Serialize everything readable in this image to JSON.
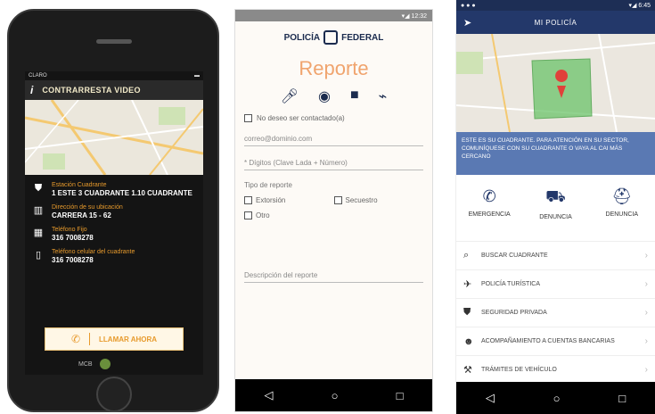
{
  "phone1": {
    "status": {
      "carrier": "CLARO",
      "time": "",
      "battery": "▬"
    },
    "header": {
      "title": "CONTRARRESTA VIDEO"
    },
    "rows": [
      {
        "icon": "shield-icon",
        "label": "Estación Cuadrante",
        "value": "1 ESTE 3 CUADRANTE 1.10 CUADRANTE"
      },
      {
        "icon": "map-icon",
        "label": "Dirección de su ubicación",
        "value": "CARRERA 15 - 62"
      },
      {
        "icon": "calendar-icon",
        "label": "Teléfono Fijo",
        "value": "316 7008278"
      },
      {
        "icon": "mobile-icon",
        "label": "Teléfono celular del cuadrante",
        "value": "316 7008278"
      }
    ],
    "call_button": "LLAMAR AHORA",
    "logos": [
      "MCB"
    ]
  },
  "phone2": {
    "status": "▾◢ 12:32",
    "brand_left": "POLICÍA",
    "brand_right": "FEDERAL",
    "title": "Reporte",
    "icons": [
      "microphone-icon",
      "camera-icon",
      "video-icon",
      "attachment-icon"
    ],
    "anonymous_label": "No deseo ser contactado(a)",
    "email_placeholder": "correo@dominio.com",
    "phone_placeholder": "* Dígitos (Clave Lada + Número)",
    "type_label": "Tipo de reporte",
    "options": [
      {
        "label": "Extorsión",
        "hint": ""
      },
      {
        "label": "Secuestro",
        "hint": ""
      },
      {
        "label": "Otro",
        "hint": ""
      }
    ],
    "description_label": "Descripción del reporte"
  },
  "phone3": {
    "status_left": "● ● ●",
    "status_right": "▾◢ 6:45",
    "app_title": "MI POLICÍA",
    "banner_text": "ESTE ES SU CUADRANTE. PARA ATENCIÓN EN SU SECTOR, COMUNÍQUESE CON SU CUADRANTE O VAYA AL CAI MÁS CERCANO",
    "actions": [
      {
        "icon": "phone-icon",
        "label": "EMERGENCIA"
      },
      {
        "icon": "car-icon",
        "label": "DENUNCIA"
      },
      {
        "icon": "police-hat-icon",
        "label": "DENUNCIA"
      }
    ],
    "list": [
      {
        "icon": "search-icon",
        "label": "BUSCAR CUADRANTE"
      },
      {
        "icon": "plane-icon",
        "label": "POLICÍA TURÍSTICA"
      },
      {
        "icon": "shield-icon",
        "label": "SEGURIDAD PRIVADA"
      },
      {
        "icon": "people-icon",
        "label": "ACOMPAÑAMIENTO A CUENTAS BANCARIAS"
      },
      {
        "icon": "tools-icon",
        "label": "TRÁMITES DE VEHÍCULO"
      }
    ]
  }
}
